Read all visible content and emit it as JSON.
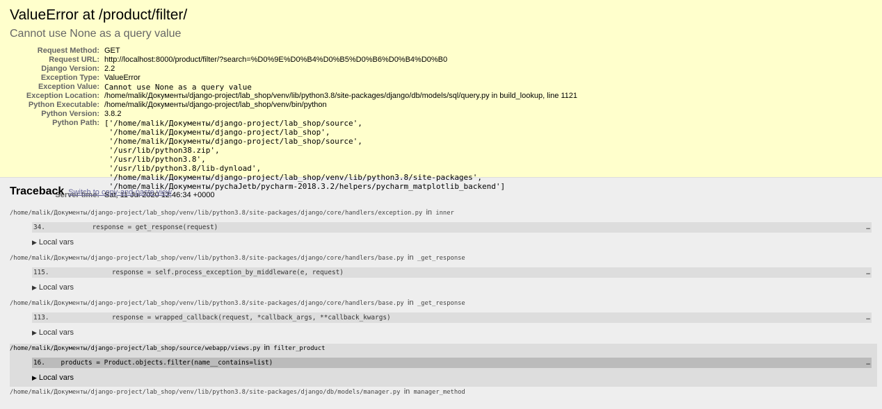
{
  "summary": {
    "title": "ValueError at /product/filter/",
    "message": "Cannot use None as a query value",
    "meta": [
      {
        "label": "Request Method:",
        "value": "GET",
        "mono": false
      },
      {
        "label": "Request URL:",
        "value": "http://localhost:8000/product/filter/?search=%D0%9E%D0%B4%D0%B5%D0%B6%D0%B4%D0%B0",
        "mono": false
      },
      {
        "label": "Django Version:",
        "value": "2.2",
        "mono": false
      },
      {
        "label": "Exception Type:",
        "value": "ValueError",
        "mono": false
      },
      {
        "label": "Exception Value:",
        "value": "Cannot use None as a query value",
        "mono": true
      },
      {
        "label": "Exception Location:",
        "value": "/home/malik/Документы/django-project/lab_shop/venv/lib/python3.8/site-packages/django/db/models/sql/query.py in build_lookup, line 1121",
        "mono": false
      },
      {
        "label": "Python Executable:",
        "value": "/home/malik/Документы/django-project/lab_shop/venv/bin/python",
        "mono": false
      },
      {
        "label": "Python Version:",
        "value": "3.8.2",
        "mono": false
      }
    ],
    "python_path_label": "Python Path:",
    "python_path": "['/home/malik/Документы/django-project/lab_shop/source',\n '/home/malik/Документы/django-project/lab_shop',\n '/home/malik/Документы/django-project/lab_shop/source',\n '/usr/lib/python38.zip',\n '/usr/lib/python3.8',\n '/usr/lib/python3.8/lib-dynload',\n '/home/malik/Документы/django-project/lab_shop/venv/lib/python3.8/site-packages',\n '/home/malik/Документы/pychaJetb/pycharm-2018.3.2/helpers/pycharm_matplotlib_backend']",
    "server_time_label": "Server time:",
    "server_time": "Sat, 11 Jul 2020 12:46:34 +0000"
  },
  "traceback": {
    "title": "Traceback",
    "switch_link": "Switch to copy-and-paste view",
    "in_word": "in",
    "local_vars": "Local vars",
    "ellipsis": "…",
    "frames": [
      {
        "file": "/home/malik/Документы/django-project/lab_shop/venv/lib/python3.8/site-packages/django/core/handlers/exception.py",
        "func": "inner",
        "line": "34.",
        "code": "            response = get_response(request)"
      },
      {
        "file": "/home/malik/Документы/django-project/lab_shop/venv/lib/python3.8/site-packages/django/core/handlers/base.py",
        "func": "_get_response",
        "line": "115.",
        "code": "                response = self.process_exception_by_middleware(e, request)"
      },
      {
        "file": "/home/malik/Документы/django-project/lab_shop/venv/lib/python3.8/site-packages/django/core/handlers/base.py",
        "func": "_get_response",
        "line": "113.",
        "code": "                response = wrapped_callback(request, *callback_args, **callback_kwargs)"
      },
      {
        "file": "/home/malik/Документы/django-project/lab_shop/source/webapp/views.py",
        "func": "filter_product",
        "line": "16.",
        "code": "    products = Product.objects.filter(name__contains=list)"
      },
      {
        "file": "/home/malik/Документы/django-project/lab_shop/venv/lib/python3.8/site-packages/django/db/models/manager.py",
        "func": "manager_method"
      }
    ]
  }
}
